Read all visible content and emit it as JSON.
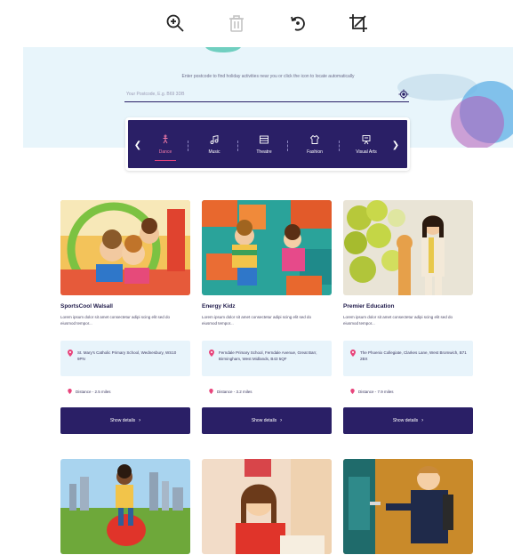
{
  "toolbar": {
    "tools": [
      "zoom-in",
      "delete",
      "rotate",
      "crop"
    ]
  },
  "hero": {
    "hint": "Enter postcode to find holiday activities near you or click the icon to locate automatically",
    "search_placeholder": "Your Postcode, E.g. B69 3DB"
  },
  "categories": {
    "items": [
      {
        "label": "Dance",
        "icon": "dance-icon",
        "active": true
      },
      {
        "label": "Music",
        "icon": "music-icon",
        "active": false
      },
      {
        "label": "Theatre",
        "icon": "theatre-icon",
        "active": false
      },
      {
        "label": "Fashion",
        "icon": "fashion-icon",
        "active": false
      },
      {
        "label": "Visual Arts",
        "icon": "visual-arts-icon",
        "active": false
      }
    ]
  },
  "cards": [
    {
      "title": "SportsCool Walsall",
      "description": "Lorem ipsum dolor sit amet consectetur adipi scing elit sed do eiusmod tempor...",
      "address": "St. Mary's Catholic Primary School, Wednesbury, WS10 9PN",
      "distance": "Distance - 2.5 miles",
      "button": "Show details"
    },
    {
      "title": "Energy Kidz",
      "description": "Lorem ipsum dolor sit amet consectetur adipi scing elit sed do eiusmod tempor...",
      "address": "Ferndale Primary School, Ferndale Avenue, Great Barr, Birmingham, West Midlands, B43 5QF",
      "distance": "Distance - 3.2 miles",
      "button": "Show details"
    },
    {
      "title": "Premier Education",
      "description": "Lorem ipsum dolor sit amet consectetur adipi scing elit sed do eiusmod tempor...",
      "address": "The Phoenix Collegiate, Clarkes Lane, West Bromwich, B71 2BX",
      "distance": "Distance - 7.9 miles",
      "button": "Show details"
    }
  ],
  "colors": {
    "brand": "#2a1f66",
    "accent": "#e8457c",
    "hero_bg": "#e8f5fb",
    "address_bg": "#e8f4fb"
  }
}
